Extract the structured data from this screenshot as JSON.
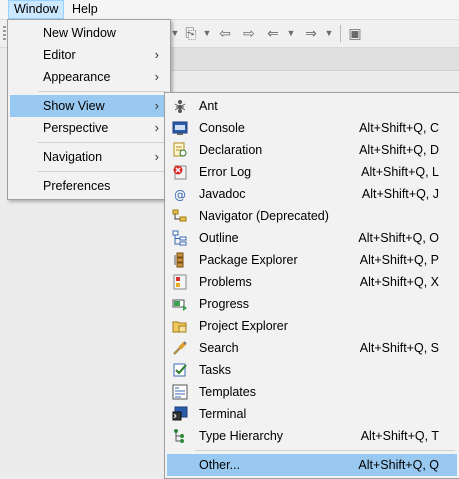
{
  "menubar": {
    "items": [
      "Window",
      "Help"
    ]
  },
  "window_menu": {
    "items": [
      {
        "label": "New Window",
        "submenu": false
      },
      {
        "label": "Editor",
        "submenu": true
      },
      {
        "label": "Appearance",
        "submenu": true
      },
      {
        "label": "Show View",
        "submenu": true,
        "highlighted": true
      },
      {
        "label": "Perspective",
        "submenu": true
      },
      {
        "label": "Navigation",
        "submenu": true
      },
      {
        "label": "Preferences",
        "submenu": false
      }
    ]
  },
  "show_view_menu": {
    "items": [
      {
        "label": "Ant",
        "accel": "",
        "icon": "ant-icon"
      },
      {
        "label": "Console",
        "accel": "Alt+Shift+Q, C",
        "icon": "console-icon"
      },
      {
        "label": "Declaration",
        "accel": "Alt+Shift+Q, D",
        "icon": "declaration-icon"
      },
      {
        "label": "Error Log",
        "accel": "Alt+Shift+Q, L",
        "icon": "error-log-icon"
      },
      {
        "label": "Javadoc",
        "accel": "Alt+Shift+Q, J",
        "icon": "javadoc-icon"
      },
      {
        "label": "Navigator (Deprecated)",
        "accel": "",
        "icon": "navigator-icon"
      },
      {
        "label": "Outline",
        "accel": "Alt+Shift+Q, O",
        "icon": "outline-icon"
      },
      {
        "label": "Package Explorer",
        "accel": "Alt+Shift+Q, P",
        "icon": "package-explorer-icon"
      },
      {
        "label": "Problems",
        "accel": "Alt+Shift+Q, X",
        "icon": "problems-icon"
      },
      {
        "label": "Progress",
        "accel": "",
        "icon": "progress-icon"
      },
      {
        "label": "Project Explorer",
        "accel": "",
        "icon": "project-explorer-icon"
      },
      {
        "label": "Search",
        "accel": "Alt+Shift+Q, S",
        "icon": "search-icon"
      },
      {
        "label": "Tasks",
        "accel": "",
        "icon": "tasks-icon"
      },
      {
        "label": "Templates",
        "accel": "",
        "icon": "templates-icon"
      },
      {
        "label": "Terminal",
        "accel": "",
        "icon": "terminal-icon"
      },
      {
        "label": "Type Hierarchy",
        "accel": "Alt+Shift+Q, T",
        "icon": "type-hierarchy-icon"
      },
      {
        "label": "Other...",
        "accel": "Alt+Shift+Q, Q",
        "icon": "",
        "highlighted": true
      }
    ]
  },
  "colors": {
    "highlight": "#99c9f0",
    "menu_bg": "#f2f2f2",
    "menubar_active": "#cce8ff"
  }
}
